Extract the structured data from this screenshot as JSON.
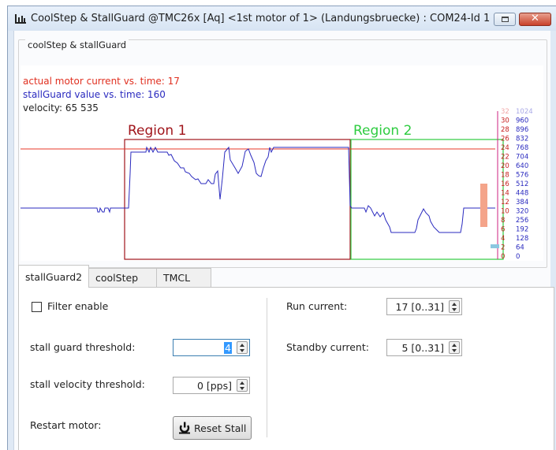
{
  "window": {
    "title": "CoolStep & StallGuard @TMC26x [Aq] <1st motor of 1> (Landungsbruecke) : COM24-Id 1",
    "restore_icon": "restore-icon",
    "close_icon": "close-icon"
  },
  "group": {
    "title": "coolStep & stallGuard"
  },
  "plot": {
    "legend": {
      "current": "actual motor current vs. time: 17",
      "stallguard": "stallGuard value vs. time: 160",
      "velocity": "velocity: 65 535"
    },
    "regions": [
      {
        "label": "Region 1",
        "color": "#a0151b"
      },
      {
        "label": "Region 2",
        "color": "#2ecc40"
      }
    ],
    "scale_left": [
      "32",
      "30",
      "28",
      "26",
      "24",
      "22",
      "20",
      "18",
      "16",
      "14",
      "12",
      "10",
      "8",
      "6",
      "4",
      "2",
      "0"
    ],
    "scale_right": [
      "1024",
      "960",
      "896",
      "832",
      "768",
      "704",
      "640",
      "576",
      "512",
      "448",
      "384",
      "320",
      "256",
      "192",
      "128",
      "64",
      "0"
    ],
    "colors": {
      "current": "#e8372a",
      "stallguard": "#2a2abf",
      "current_bar": "#f4a48a",
      "stallguard_bar": "#8cc7e0"
    }
  },
  "tabs": [
    "stallGuard2",
    "coolStep",
    "TMCL"
  ],
  "panel": {
    "filter_label": "Filter enable",
    "threshold_label": "stall guard threshold:",
    "threshold_value": "4",
    "velocity_threshold_label": "stall velocity threshold:",
    "velocity_threshold_value": "0 [pps]",
    "restart_label": "Restart motor:",
    "reset_button": "Reset Stall",
    "run_current_label": "Run current:",
    "run_current_value": "17 [0..31]",
    "standby_current_label": "Standby current:",
    "standby_current_value": "5 [0..31]"
  }
}
